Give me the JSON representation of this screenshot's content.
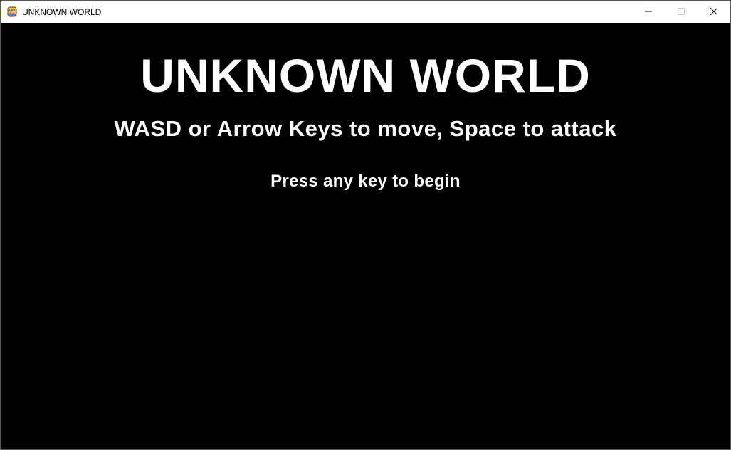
{
  "window": {
    "title": "UNKNOWN WORLD",
    "app_icon": "pygame-snake-icon",
    "controls": {
      "minimize_icon": "minimize-icon",
      "maximize_icon": "maximize-icon",
      "close_icon": "close-icon"
    }
  },
  "game": {
    "title": "UNKNOWN WORLD",
    "instructions": "WASD or Arrow Keys to move, Space to attack",
    "prompt": "Press any key to begin",
    "colors": {
      "background": "#000000",
      "text": "#ffffff"
    }
  }
}
